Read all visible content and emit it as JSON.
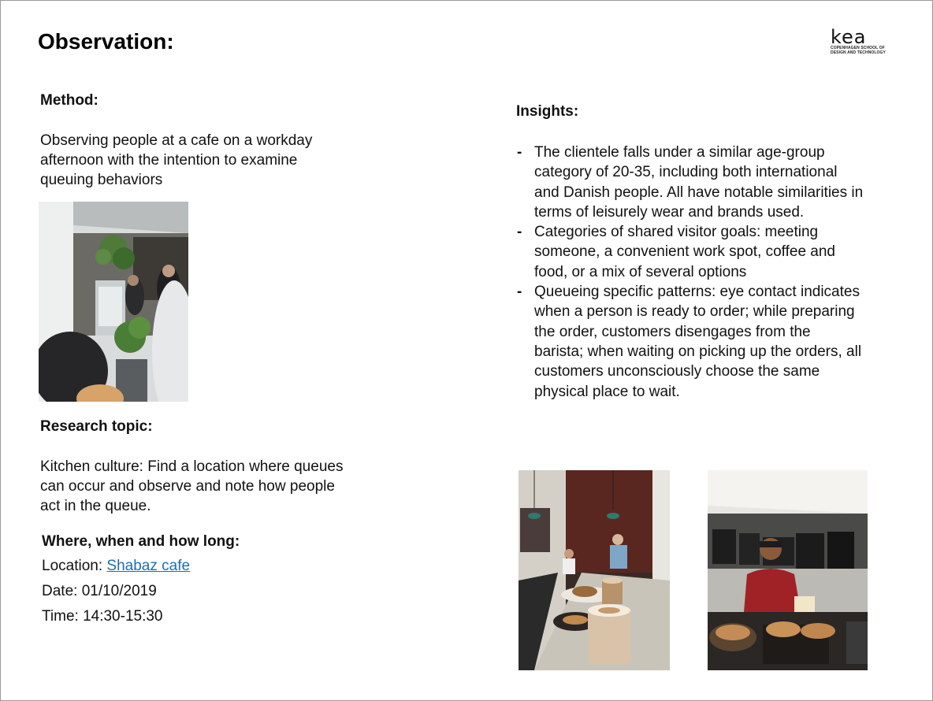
{
  "title": "Observation:",
  "logo": {
    "word": "kea",
    "subtitle": "COPENHAGEN SCHOOL OF DESIGN AND TECHNOLOGY"
  },
  "method": {
    "heading": "Method:",
    "text": "Observing people at a cafe on a workday afternoon with the intention to examine queuing behaviors"
  },
  "research": {
    "heading": "Research topic:",
    "text": "Kitchen culture: Find a location where queues can occur and observe and note how people act in the queue."
  },
  "where": {
    "heading": "Where, when and how long:",
    "location_label": "Location: ",
    "location_link": "Shabaz cafe",
    "date": "Date: 01/10/2019",
    "time": "Time: 14:30-15:30"
  },
  "insights": {
    "heading": "Insights:",
    "items": [
      "The clientele falls under a similar age-group category of 20-35, including both international and Danish people. All have notable similarities in terms of leisurely wear and brands used.",
      "Categories of shared visitor goals: meeting someone, a convenient work spot, coffee and food, or a mix of several options",
      "Queueing specific patterns: eye contact indicates when a person is ready to order; while preparing the order, customers disengages from the barista; when waiting on picking up the orders, all customers unconsciously choose the same physical place to wait."
    ]
  },
  "colors": {
    "link": "#1a6fb5"
  }
}
